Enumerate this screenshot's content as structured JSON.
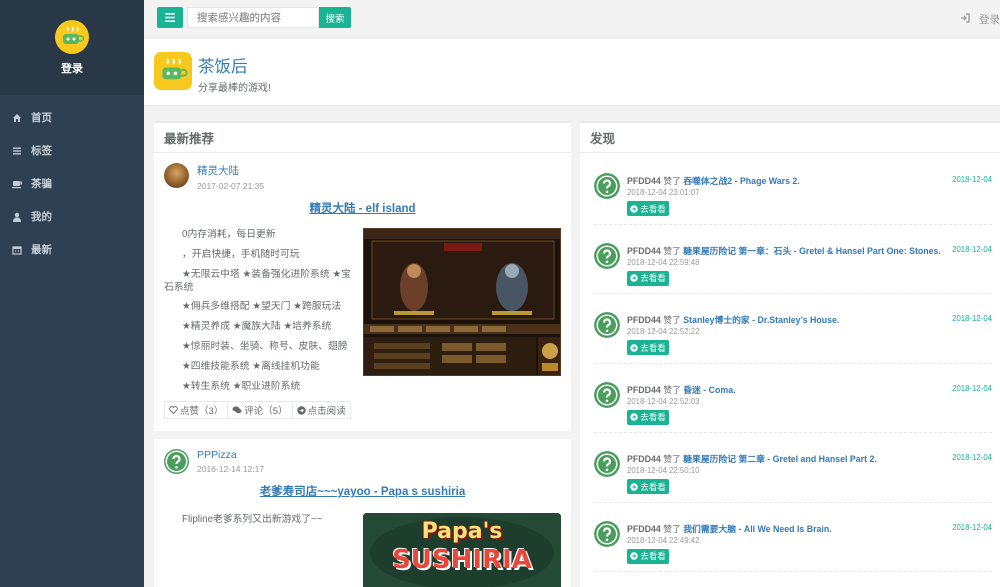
{
  "sidebar": {
    "login": "登录",
    "items": [
      {
        "label": "首页",
        "icon": "home-icon"
      },
      {
        "label": "标签",
        "icon": "list-icon"
      },
      {
        "label": "茶骗",
        "icon": "coffee-icon"
      },
      {
        "label": "我的",
        "icon": "user-icon"
      },
      {
        "label": "最新",
        "icon": "calendar-icon"
      }
    ]
  },
  "topbar": {
    "search_placeholder": "搜索感兴趣的内容",
    "search_button": "搜索",
    "login": "登录"
  },
  "header": {
    "title": "茶饭后",
    "subtitle": "分享最棒的游戏!"
  },
  "latest": {
    "title": "最新推荐",
    "posts": [
      {
        "author": "精灵大陆",
        "time": "2017-02-07 21:35",
        "title": "精灵大陆 - elf island",
        "lines": [
          "0内存消耗，每日更新",
          "，开启快捷，手机随时可玩",
          "★无限云中塔 ★装备强化进阶系统 ★宝石系统",
          "★佣兵多维搭配 ★望天门 ★跨服玩法",
          "★精灵养成 ★魔族大陆 ★培养系统",
          "★惊丽时装、坐骑、称号、皮肤、翅膀",
          "★四维技能系统 ★离线挂机功能",
          "★转生系统 ★职业进阶系统"
        ],
        "like": "点赞（3）",
        "comment": "评论（5）",
        "read": "点击阅读"
      },
      {
        "author": "PPPizza",
        "time": "2016-12-14 12:17",
        "title": "老爹寿司店~~~yayoo - Papa s sushiria",
        "lines": [
          "Flipline老爹系列又出新游戏了~~"
        ],
        "image_text_top": "Papa's",
        "image_text_bottom": "SUSHIRIA"
      }
    ]
  },
  "discover": {
    "title": "发现",
    "items": [
      {
        "user": "PFDD44",
        "verb": "赞了",
        "game": "吞噬体之战2 - Phage Wars 2.",
        "time": "2018-12-04 23:01:07",
        "date": "2018-12-04",
        "button": "去看看"
      },
      {
        "user": "PFDD44",
        "verb": "赞了",
        "game": "糖果屋历险记 第一章：石头 - Gretel & Hansel Part One: Stones.",
        "time": "2018-12-04 22:59:48",
        "date": "2018-12-04",
        "button": "去看看"
      },
      {
        "user": "PFDD44",
        "verb": "赞了",
        "game": "Stanley博士的家 - Dr.Stanley’s House.",
        "time": "2018-12-04 22:52:22",
        "date": "2018-12-04",
        "button": "去看看"
      },
      {
        "user": "PFDD44",
        "verb": "赞了",
        "game": "昏迷 - Coma.",
        "time": "2018-12-04 22:52:03",
        "date": "2018-12-04",
        "button": "去看看"
      },
      {
        "user": "PFDD44",
        "verb": "赞了",
        "game": "糖果屋历险记 第二章 - Gretel and Hansel Part 2.",
        "time": "2018-12-04 22:50:10",
        "date": "2018-12-04",
        "button": "去看看"
      },
      {
        "user": "PFDD44",
        "verb": "赞了",
        "game": "我们需要大脑 - All We Need Is Brain.",
        "time": "2018-12-04 22:49:42",
        "date": "2018-12-04",
        "button": "去看看"
      }
    ]
  },
  "colors": {
    "accent": "#1ab394",
    "sidebar": "#2f4050",
    "link": "#337ab7"
  }
}
